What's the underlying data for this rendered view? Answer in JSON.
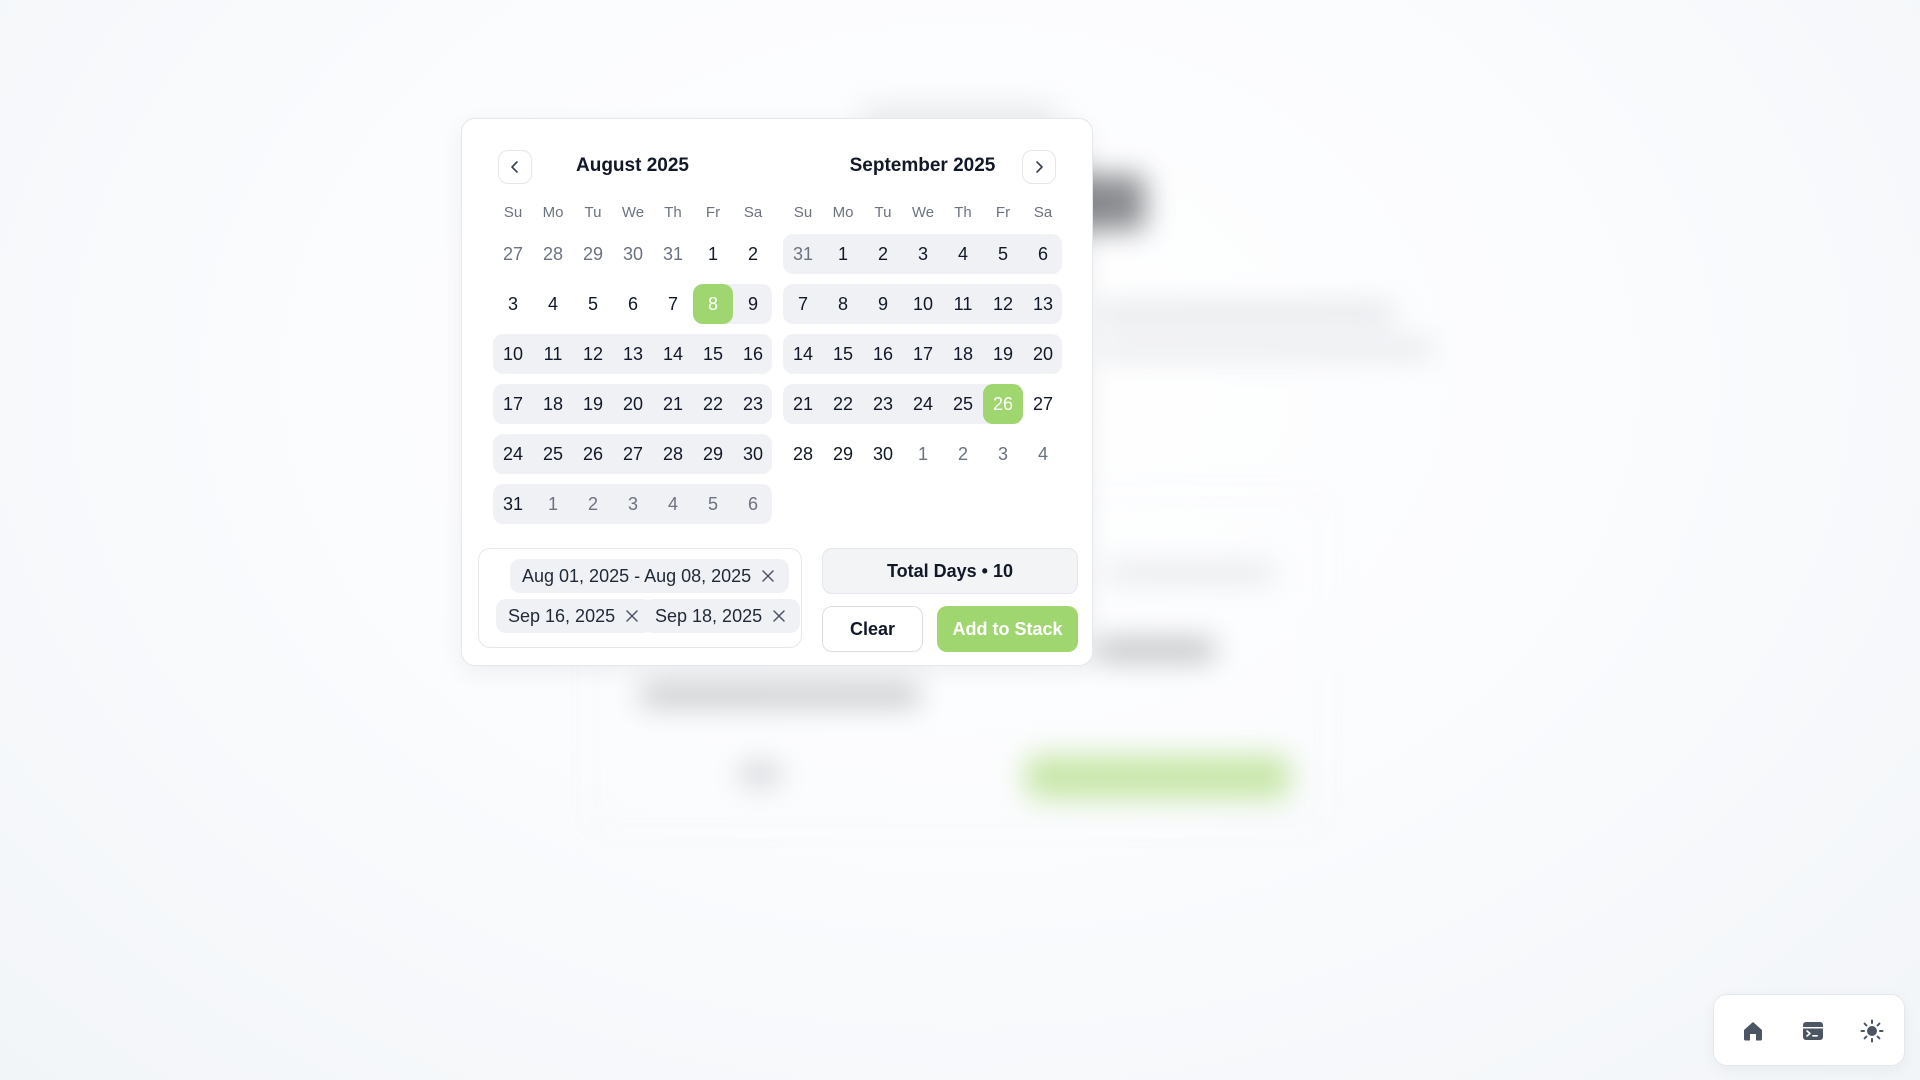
{
  "background_note": "",
  "calendar": {
    "prev_icon": "chevron-left-icon",
    "next_icon": "chevron-right-icon",
    "weekdays": [
      "Su",
      "Mo",
      "Tu",
      "We",
      "Th",
      "Fr",
      "Sa"
    ],
    "months": [
      {
        "title": "August 2025",
        "weeks": [
          {
            "band": "none",
            "days": [
              {
                "d": "27",
                "s": "outside"
              },
              {
                "d": "28",
                "s": "outside"
              },
              {
                "d": "29",
                "s": "outside"
              },
              {
                "d": "30",
                "s": "outside"
              },
              {
                "d": "31",
                "s": "outside"
              },
              {
                "d": "1",
                "s": "normal"
              },
              {
                "d": "2",
                "s": "normal"
              }
            ]
          },
          {
            "band": "after-selected",
            "days": [
              {
                "d": "3",
                "s": "normal"
              },
              {
                "d": "4",
                "s": "normal"
              },
              {
                "d": "5",
                "s": "normal"
              },
              {
                "d": "6",
                "s": "normal"
              },
              {
                "d": "7",
                "s": "normal"
              },
              {
                "d": "8",
                "s": "selected"
              },
              {
                "d": "9",
                "s": "normal"
              }
            ]
          },
          {
            "band": "full",
            "days": [
              {
                "d": "10",
                "s": "normal"
              },
              {
                "d": "11",
                "s": "normal"
              },
              {
                "d": "12",
                "s": "normal"
              },
              {
                "d": "13",
                "s": "normal"
              },
              {
                "d": "14",
                "s": "normal"
              },
              {
                "d": "15",
                "s": "normal"
              },
              {
                "d": "16",
                "s": "normal"
              }
            ]
          },
          {
            "band": "full",
            "days": [
              {
                "d": "17",
                "s": "normal"
              },
              {
                "d": "18",
                "s": "normal"
              },
              {
                "d": "19",
                "s": "normal"
              },
              {
                "d": "20",
                "s": "normal"
              },
              {
                "d": "21",
                "s": "normal"
              },
              {
                "d": "22",
                "s": "normal"
              },
              {
                "d": "23",
                "s": "normal"
              }
            ]
          },
          {
            "band": "full",
            "days": [
              {
                "d": "24",
                "s": "normal"
              },
              {
                "d": "25",
                "s": "normal"
              },
              {
                "d": "26",
                "s": "normal"
              },
              {
                "d": "27",
                "s": "normal"
              },
              {
                "d": "28",
                "s": "normal"
              },
              {
                "d": "29",
                "s": "normal"
              },
              {
                "d": "30",
                "s": "normal"
              }
            ]
          },
          {
            "band": "full",
            "days": [
              {
                "d": "31",
                "s": "normal"
              },
              {
                "d": "1",
                "s": "outside"
              },
              {
                "d": "2",
                "s": "outside"
              },
              {
                "d": "3",
                "s": "outside"
              },
              {
                "d": "4",
                "s": "outside"
              },
              {
                "d": "5",
                "s": "outside"
              },
              {
                "d": "6",
                "s": "outside"
              }
            ]
          }
        ]
      },
      {
        "title": "September 2025",
        "weeks": [
          {
            "band": "full",
            "days": [
              {
                "d": "31",
                "s": "outside"
              },
              {
                "d": "1",
                "s": "normal"
              },
              {
                "d": "2",
                "s": "normal"
              },
              {
                "d": "3",
                "s": "normal"
              },
              {
                "d": "4",
                "s": "normal"
              },
              {
                "d": "5",
                "s": "normal"
              },
              {
                "d": "6",
                "s": "normal"
              }
            ]
          },
          {
            "band": "full",
            "days": [
              {
                "d": "7",
                "s": "normal"
              },
              {
                "d": "8",
                "s": "normal"
              },
              {
                "d": "9",
                "s": "normal"
              },
              {
                "d": "10",
                "s": "normal"
              },
              {
                "d": "11",
                "s": "normal"
              },
              {
                "d": "12",
                "s": "normal"
              },
              {
                "d": "13",
                "s": "normal"
              }
            ]
          },
          {
            "band": "full",
            "days": [
              {
                "d": "14",
                "s": "normal"
              },
              {
                "d": "15",
                "s": "normal"
              },
              {
                "d": "16",
                "s": "normal"
              },
              {
                "d": "17",
                "s": "normal"
              },
              {
                "d": "18",
                "s": "normal"
              },
              {
                "d": "19",
                "s": "normal"
              },
              {
                "d": "20",
                "s": "normal"
              }
            ]
          },
          {
            "band": "until-selected",
            "days": [
              {
                "d": "21",
                "s": "normal"
              },
              {
                "d": "22",
                "s": "normal"
              },
              {
                "d": "23",
                "s": "normal"
              },
              {
                "d": "24",
                "s": "normal"
              },
              {
                "d": "25",
                "s": "normal"
              },
              {
                "d": "26",
                "s": "selected"
              },
              {
                "d": "27",
                "s": "normal"
              }
            ]
          },
          {
            "band": "none",
            "days": [
              {
                "d": "28",
                "s": "normal"
              },
              {
                "d": "29",
                "s": "normal"
              },
              {
                "d": "30",
                "s": "normal"
              },
              {
                "d": "1",
                "s": "outside"
              },
              {
                "d": "2",
                "s": "outside"
              },
              {
                "d": "3",
                "s": "outside"
              },
              {
                "d": "4",
                "s": "outside"
              }
            ]
          }
        ]
      }
    ]
  },
  "selections": {
    "chips": [
      {
        "label": "Aug 01, 2025 - Aug 08, 2025"
      },
      {
        "label": "Sep 16, 2025"
      },
      {
        "label": "Sep 18, 2025"
      }
    ],
    "remove_icon": "close-icon"
  },
  "summary": {
    "total_days_label": "Total Days • 10"
  },
  "actions": {
    "clear_label": "Clear",
    "add_label": "Add to Stack"
  },
  "dock": {
    "items": [
      {
        "icon": "home-icon"
      },
      {
        "icon": "terminal-window-icon"
      },
      {
        "icon": "sun-icon"
      }
    ]
  },
  "colors": {
    "accent": "#9fd670",
    "band": "#f0f1f4",
    "text": "#111827",
    "muted": "#6b7280",
    "border": "#e4e7ec"
  }
}
